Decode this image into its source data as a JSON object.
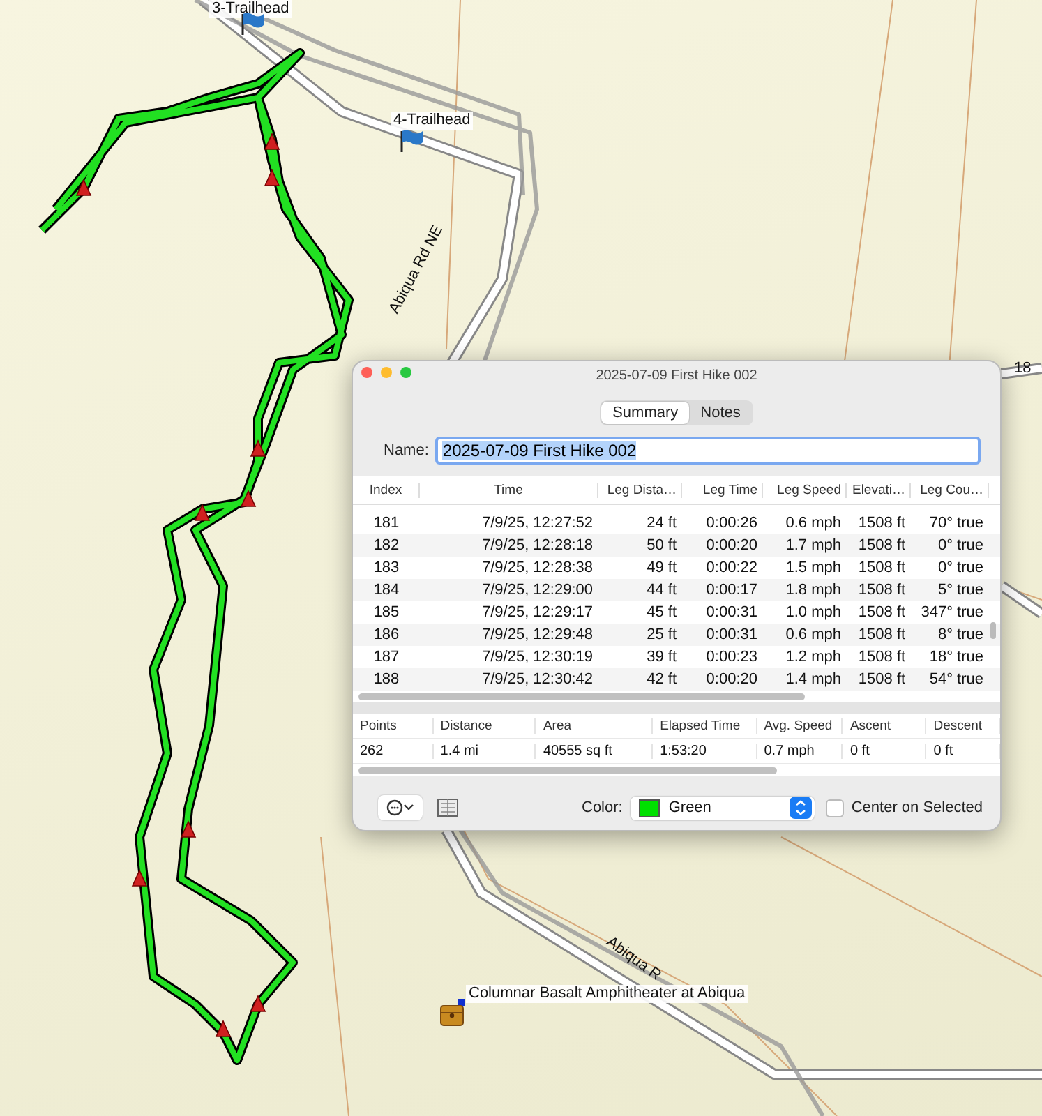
{
  "map": {
    "waypoints": [
      {
        "label": "3-Trailhead"
      },
      {
        "label": "4-Trailhead"
      }
    ],
    "road_labels": [
      "Abiqua Rd NE",
      "Abiqua R",
      "18"
    ],
    "poi": {
      "label": "Columnar Basalt Amphitheater at Abiqua"
    }
  },
  "window": {
    "title": "2025-07-09 First Hike 002",
    "tabs": [
      {
        "label": "Summary",
        "selected": true
      },
      {
        "label": "Notes",
        "selected": false
      }
    ],
    "name_label": "Name:",
    "name_value": "2025-07-09 First Hike 002",
    "table": {
      "columns": [
        "Index",
        "Time",
        "Leg Dista…",
        "Leg Time",
        "Leg Speed",
        "Elevati…",
        "Leg Cou…"
      ],
      "rows": [
        [
          "181",
          "7/9/25, 12:27:52",
          "24 ft",
          "0:00:26",
          "0.6 mph",
          "1508 ft",
          "70° true"
        ],
        [
          "182",
          "7/9/25, 12:28:18",
          "50 ft",
          "0:00:20",
          "1.7 mph",
          "1508 ft",
          "0° true"
        ],
        [
          "183",
          "7/9/25, 12:28:38",
          "49 ft",
          "0:00:22",
          "1.5 mph",
          "1508 ft",
          "0° true"
        ],
        [
          "184",
          "7/9/25, 12:29:00",
          "44 ft",
          "0:00:17",
          "1.8 mph",
          "1508 ft",
          "5° true"
        ],
        [
          "185",
          "7/9/25, 12:29:17",
          "45 ft",
          "0:00:31",
          "1.0 mph",
          "1508 ft",
          "347° true"
        ],
        [
          "186",
          "7/9/25, 12:29:48",
          "25 ft",
          "0:00:31",
          "0.6 mph",
          "1508 ft",
          "8° true"
        ],
        [
          "187",
          "7/9/25, 12:30:19",
          "39 ft",
          "0:00:23",
          "1.2 mph",
          "1508 ft",
          "18° true"
        ],
        [
          "188",
          "7/9/25, 12:30:42",
          "42 ft",
          "0:00:20",
          "1.4 mph",
          "1508 ft",
          "54° true"
        ]
      ]
    },
    "stats": {
      "columns": [
        "Points",
        "Distance",
        "Area",
        "Elapsed Time",
        "Avg. Speed",
        "Ascent",
        "Descent"
      ],
      "values": [
        "262",
        "1.4 mi",
        "40555 sq ft",
        "1:53:20",
        "0.7 mph",
        "0 ft",
        "0 ft"
      ]
    },
    "color_label": "Color:",
    "color": {
      "value": "Green",
      "color": "#00e000"
    },
    "center_on_selected": {
      "label": "Center on Selected",
      "checked": false
    }
  }
}
